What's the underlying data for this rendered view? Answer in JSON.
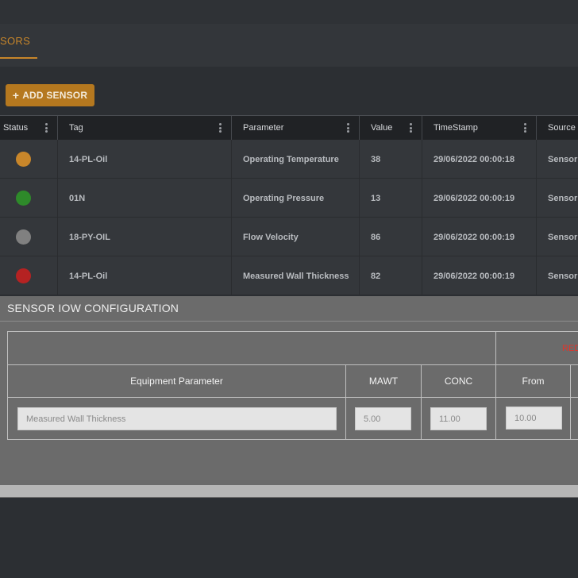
{
  "tabs": {
    "active_label": "SORS"
  },
  "toolbar": {
    "add_sensor_label": "ADD SENSOR",
    "add_icon": "plus-icon"
  },
  "grid": {
    "columns": [
      "Status",
      "Tag",
      "Parameter",
      "Value",
      "TimeStamp",
      "Source"
    ],
    "rows": [
      {
        "status_color": "#c8862a",
        "tag": "14-PL-Oil",
        "parameter": "Operating Temperature",
        "value": "38",
        "timestamp": "29/06/2022 00:00:18",
        "source": "Sensor"
      },
      {
        "status_color": "#2e8a2a",
        "tag": "01N",
        "parameter": "Operating Pressure",
        "value": "13",
        "timestamp": "29/06/2022 00:00:19",
        "source": "Sensor"
      },
      {
        "status_color": "#808080",
        "tag": "18-PY-OIL",
        "parameter": "Flow Velocity",
        "value": "86",
        "timestamp": "29/06/2022 00:00:19",
        "source": "Sensor"
      },
      {
        "status_color": "#b52222",
        "tag": "14-PL-Oil",
        "parameter": "Measured Wall Thickness",
        "value": "82",
        "timestamp": "29/06/2022 00:00:19",
        "source": "Sensor"
      }
    ]
  },
  "config": {
    "title": "SENSOR IOW CONFIGURATION",
    "group_label": "RED",
    "headers": {
      "equipment_parameter": "Equipment Parameter",
      "mawt": "MAWT",
      "conc": "CONC",
      "from": "From"
    },
    "values": {
      "equipment_parameter": "Measured Wall Thickness",
      "mawt": "5.00",
      "conc": "11.00",
      "from": "10.00"
    }
  }
}
